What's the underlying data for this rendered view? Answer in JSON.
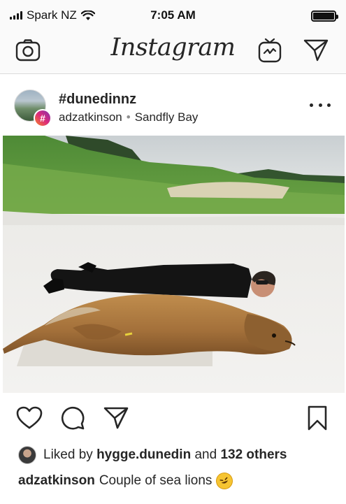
{
  "status_bar": {
    "carrier": "Spark NZ",
    "time": "7:05 AM"
  },
  "header": {
    "logo": "Instagram",
    "icons": [
      "camera-icon",
      "igtv-icon",
      "direct-message-icon"
    ]
  },
  "post": {
    "title": "#dunedinnz",
    "username": "adzatkinson",
    "separator": "•",
    "location": "Sandfly Bay",
    "badge": "#",
    "image_alt": "Man lying on sand beside a sea lion at Sandfly Bay"
  },
  "actions": {
    "icons": [
      "heart-icon",
      "comment-icon",
      "share-icon",
      "bookmark-icon"
    ]
  },
  "likes": {
    "prefix": "Liked by",
    "user": "hygge.dunedin",
    "middle": "and",
    "count": "132 others"
  },
  "caption": {
    "username": "adzatkinson",
    "text": "Couple of sea lions",
    "emoji_icon": "rolling-laughing-emoji"
  },
  "colors": {
    "text": "#262626",
    "muted": "#8e8e8e",
    "header_bg": "#fafafa",
    "divider": "#dbdbdb"
  }
}
